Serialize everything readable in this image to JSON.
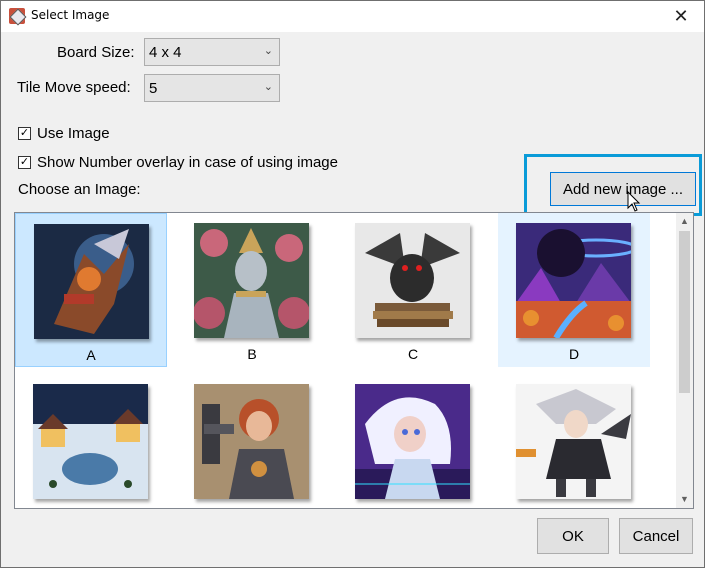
{
  "window": {
    "title": "Select Image"
  },
  "board_size": {
    "label": "Board Size:",
    "value": "4 x 4"
  },
  "tile_speed": {
    "label": "Tile Move speed:",
    "value": "5"
  },
  "use_image": {
    "label": "Use Image",
    "checked": true
  },
  "show_number": {
    "label": "Show Number overlay in case of using image",
    "checked": true
  },
  "choose_label": "Choose an Image:",
  "add_button": "Add new image ...",
  "images": [
    {
      "caption": "A",
      "icon": "mech-warrior-image",
      "selected": true
    },
    {
      "caption": "B",
      "icon": "goddess-statue-image",
      "selected": false
    },
    {
      "caption": "C",
      "icon": "dragon-on-books-image",
      "selected": false
    },
    {
      "caption": "D",
      "icon": "planet-landscape-image",
      "hover": true
    },
    {
      "caption": "",
      "icon": "winter-village-image"
    },
    {
      "caption": "",
      "icon": "armored-woman-image"
    },
    {
      "caption": "",
      "icon": "cyber-girl-image"
    },
    {
      "caption": "",
      "icon": "anime-fighter-image"
    }
  ],
  "buttons": {
    "ok": "OK",
    "cancel": "Cancel"
  }
}
